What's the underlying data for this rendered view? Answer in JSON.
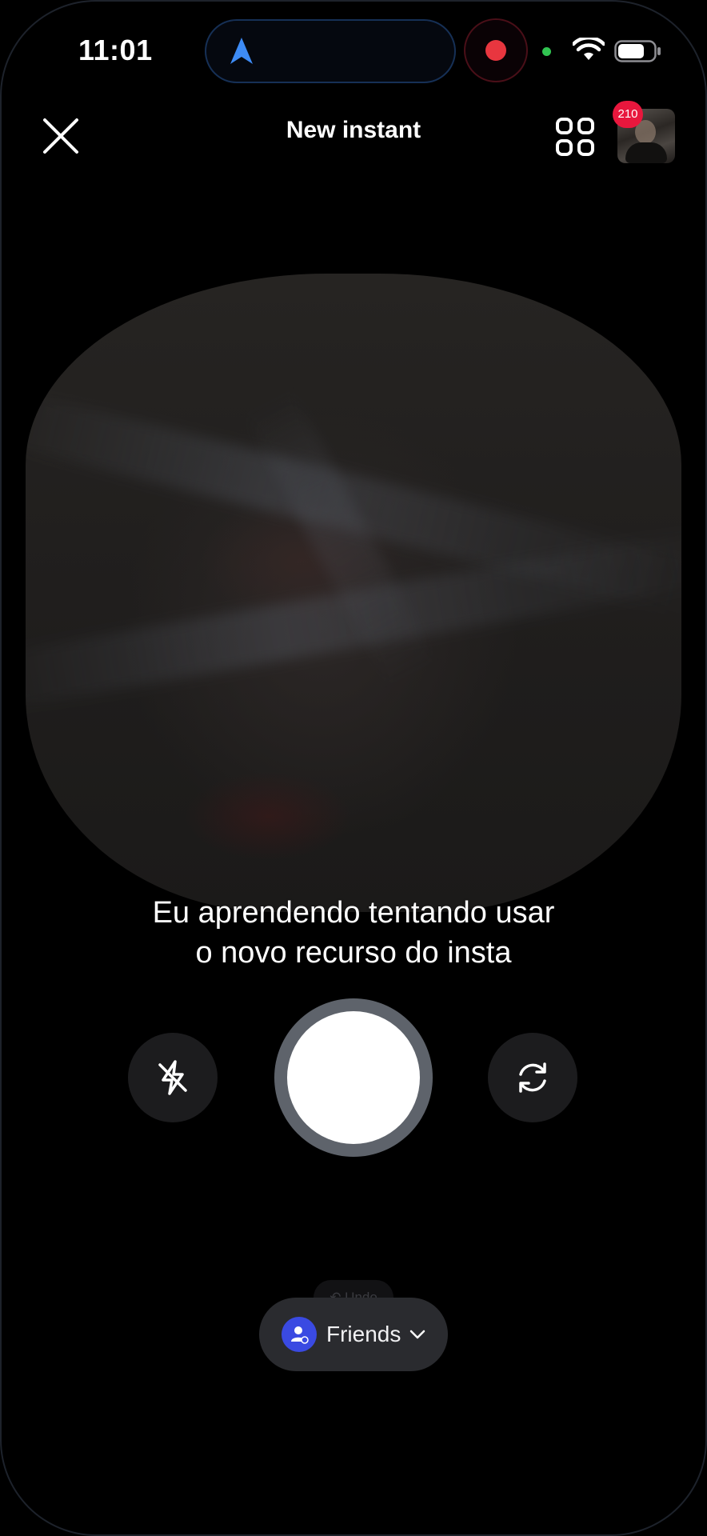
{
  "status_bar": {
    "time": "11:01"
  },
  "header": {
    "title": "New instant",
    "notification_count": "210"
  },
  "caption": {
    "line1": "Eu aprendendo tentando usar",
    "line2": "o novo recurso do insta"
  },
  "undo": {
    "label": "Undo"
  },
  "audience": {
    "label": "Friends"
  },
  "icons": {
    "close": "close-icon",
    "grid": "grid-icon",
    "flash": "flash-off-icon",
    "flip": "flip-camera-icon",
    "friends": "friends-icon",
    "chevron": "chevron-down-icon",
    "navigation": "navigation-arrow-icon",
    "wifi": "wifi-icon",
    "battery": "battery-icon"
  },
  "colors": {
    "background": "#000000",
    "badge": "#e8173d",
    "recording": "#e8363f",
    "friends_accent": "#3a4ae2",
    "shutter_ring": "#5e636b",
    "control_button": "#1c1c1e"
  }
}
